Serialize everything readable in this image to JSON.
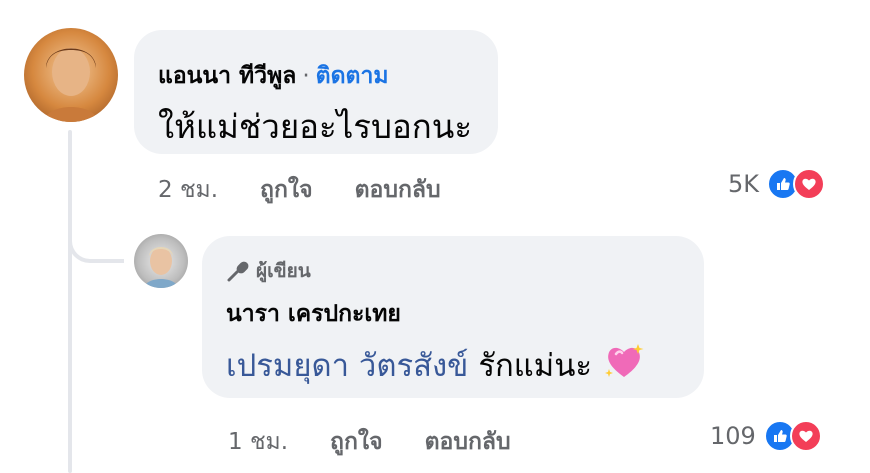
{
  "comment": {
    "author": "แอนนา ทีวีพูล",
    "separator": "·",
    "follow_label": "ติดตาม",
    "text": "ให้แม่ช่วยอะไรบอกนะ",
    "time": "2 ชม.",
    "like_label": "ถูกใจ",
    "reply_label": "ตอบกลับ",
    "reaction_count": "5K",
    "reaction_icons": [
      "like-icon",
      "love-icon"
    ]
  },
  "reply": {
    "badge_label": "ผู้เขียน",
    "badge_icon": "microphone-icon",
    "author": "นารา เครปกะเทย",
    "mention": "เปรมยุดา วัตรสังข์",
    "text": "รักแม่นะ",
    "emoji": "💖",
    "time": "1 ชม.",
    "like_label": "ถูกใจ",
    "reply_label": "ตอบกลับ",
    "reaction_count": "109",
    "reaction_icons": [
      "like-icon",
      "love-icon"
    ]
  },
  "colors": {
    "bubble": "#f0f2f5",
    "link": "#1b74e4",
    "mention": "#385898",
    "meta": "#65676b",
    "like": "#1877f2",
    "love": "#f33e58"
  }
}
